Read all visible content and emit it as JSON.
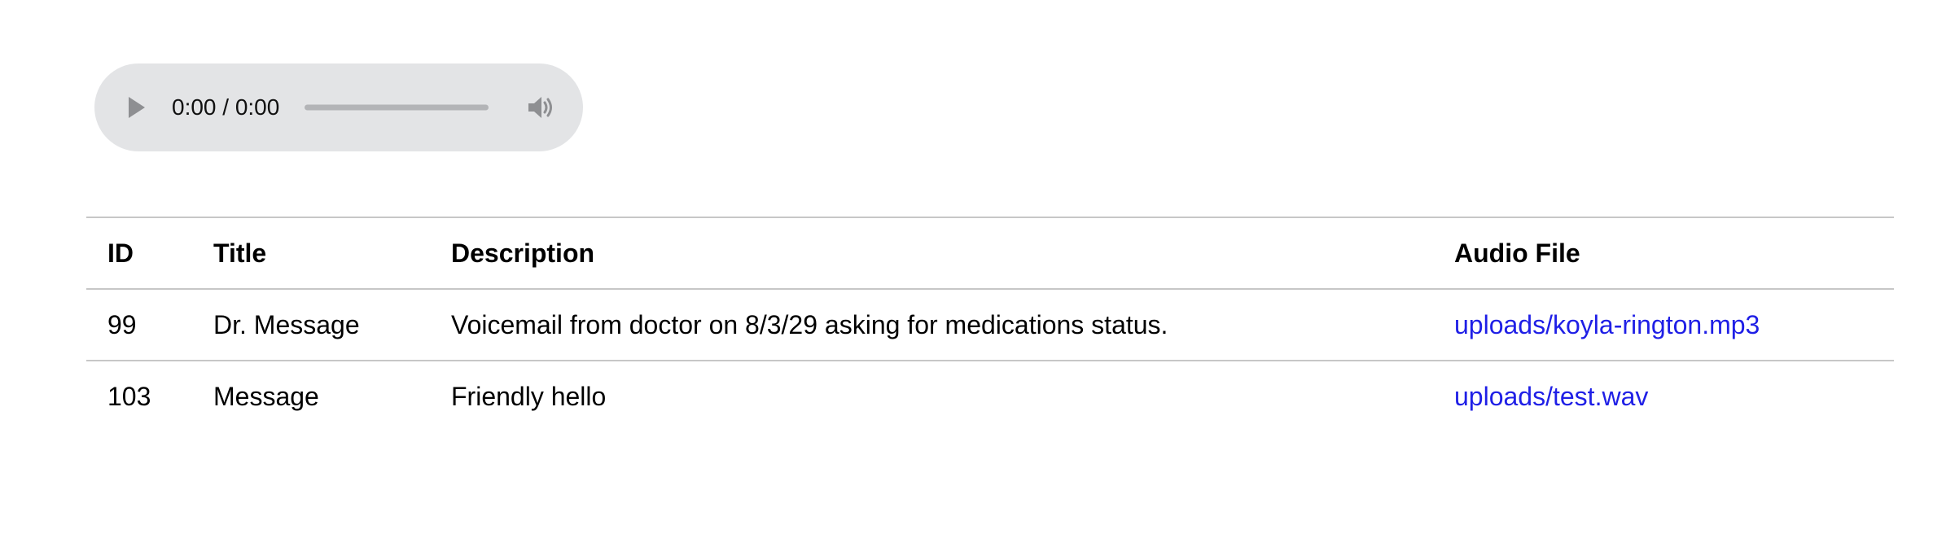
{
  "audio_player": {
    "time": "0:00 / 0:00",
    "progress": 0,
    "play_icon": "play-icon",
    "volume_icon": "speaker-icon"
  },
  "table": {
    "headers": {
      "id": "ID",
      "title": "Title",
      "description": "Description",
      "audio_file": "Audio File"
    },
    "rows": [
      {
        "id": "99",
        "title": "Dr. Message",
        "description": "Voicemail from doctor on 8/3/29 asking for medications status.",
        "audio_file": "uploads/koyla-rington.mp3"
      },
      {
        "id": "103",
        "title": "Message",
        "description": "Friendly hello",
        "audio_file": "uploads/test.wav"
      }
    ]
  },
  "colors": {
    "link": "#1f1fe6",
    "player_bg": "#e3e4e6",
    "divider": "#c7c7c7"
  }
}
